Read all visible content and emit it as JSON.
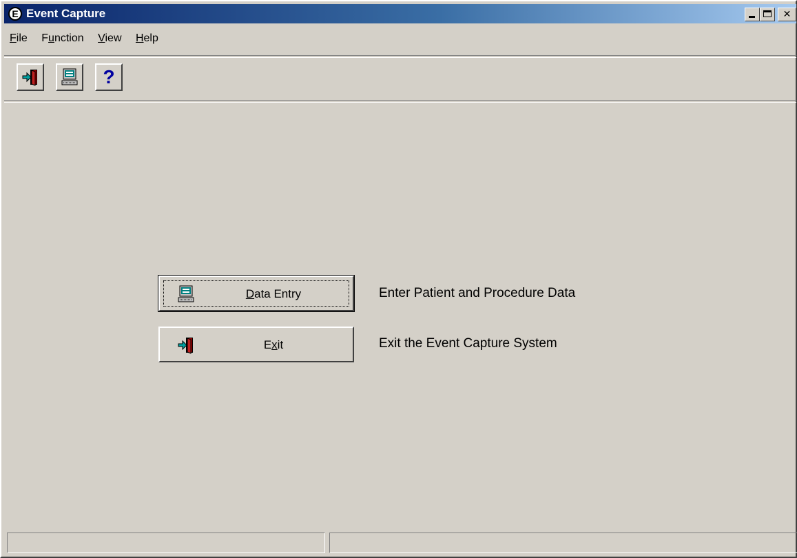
{
  "window": {
    "title": "Event Capture",
    "app_icon_letter": "E"
  },
  "menubar": {
    "items": [
      {
        "accel": "F",
        "rest": "ile"
      },
      {
        "pre": "F",
        "accel": "u",
        "rest": "nction"
      },
      {
        "accel": "V",
        "rest": "iew"
      },
      {
        "accel": "H",
        "rest": "elp"
      }
    ]
  },
  "toolbar": {
    "buttons": [
      {
        "icon": "exit-door-icon"
      },
      {
        "icon": "computer-icon"
      },
      {
        "icon": "help-icon",
        "glyph": "?"
      }
    ]
  },
  "main": {
    "data_entry": {
      "accel": "D",
      "rest": "ata Entry",
      "description": "Enter Patient and Procedure Data",
      "icon": "computer-icon"
    },
    "exit": {
      "pre": "E",
      "accel": "x",
      "rest": "it",
      "description": "Exit the Event Capture System",
      "icon": "exit-door-icon"
    }
  },
  "statusbar": {
    "panel_left": "",
    "panel_right": ""
  }
}
